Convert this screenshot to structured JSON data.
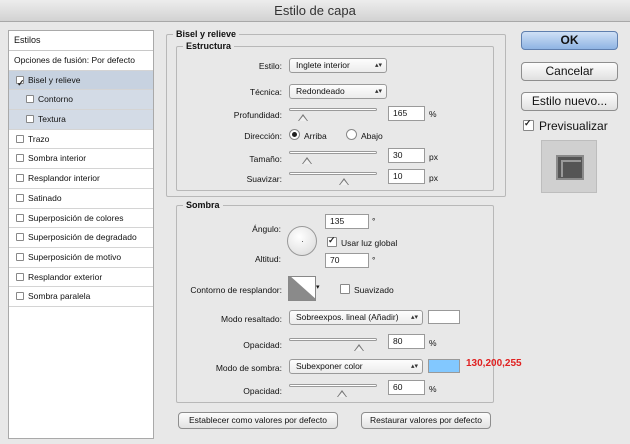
{
  "window": {
    "title": "Estilo de capa"
  },
  "left_panel": {
    "header": "Estilos",
    "items": [
      {
        "label": "Opciones de fusión: Por defecto",
        "checkbox": false,
        "checked": false,
        "selected": false,
        "sub": false
      },
      {
        "label": "Bisel y relieve",
        "checkbox": true,
        "checked": true,
        "selected": true,
        "sub": false
      },
      {
        "label": "Contorno",
        "checkbox": true,
        "checked": false,
        "selected": true,
        "sub": true
      },
      {
        "label": "Textura",
        "checkbox": true,
        "checked": false,
        "selected": true,
        "sub": true
      },
      {
        "label": "Trazo",
        "checkbox": true,
        "checked": false,
        "selected": false,
        "sub": false
      },
      {
        "label": "Sombra interior",
        "checkbox": true,
        "checked": false,
        "selected": false,
        "sub": false
      },
      {
        "label": "Resplandor interior",
        "checkbox": true,
        "checked": false,
        "selected": false,
        "sub": false
      },
      {
        "label": "Satinado",
        "checkbox": true,
        "checked": false,
        "selected": false,
        "sub": false
      },
      {
        "label": "Superposición de colores",
        "checkbox": true,
        "checked": false,
        "selected": false,
        "sub": false
      },
      {
        "label": "Superposición de degradado",
        "checkbox": true,
        "checked": false,
        "selected": false,
        "sub": false
      },
      {
        "label": "Superposición de motivo",
        "checkbox": true,
        "checked": false,
        "selected": false,
        "sub": false
      },
      {
        "label": "Resplandor exterior",
        "checkbox": true,
        "checked": false,
        "selected": false,
        "sub": false
      },
      {
        "label": "Sombra paralela",
        "checkbox": true,
        "checked": false,
        "selected": false,
        "sub": false
      }
    ]
  },
  "bevel": {
    "section_title": "Bisel y relieve",
    "structure_title": "Estructura",
    "style_label": "Estilo:",
    "style_value": "Inglete interior",
    "technique_label": "Técnica:",
    "technique_value": "Redondeado",
    "depth_label": "Profundidad:",
    "depth_value": "165",
    "depth_unit": "%",
    "depth_fraction": 0.16,
    "direction_label": "Dirección:",
    "direction_up": "Arriba",
    "direction_down": "Abajo",
    "size_label": "Tamaño:",
    "size_value": "30",
    "size_unit": "px",
    "size_fraction": 0.2,
    "soften_label": "Suavizar:",
    "soften_value": "10",
    "soften_unit": "px",
    "soften_fraction": 0.62
  },
  "shading": {
    "title": "Sombra",
    "angle_label": "Ángulo:",
    "angle_value": "135",
    "angle_unit": "°",
    "global_light_label": "Usar luz global",
    "altitude_label": "Altitud:",
    "altitude_value": "70",
    "altitude_unit": "°",
    "gloss_contour_label": "Contorno de resplandor:",
    "antialiased_label": "Suavizado",
    "highlight_mode_label": "Modo resaltado:",
    "highlight_mode_value": "Sobreexpos. lineal (Añadir)",
    "highlight_color": "#ffffff",
    "highlight_opacity_label": "Opacidad:",
    "highlight_opacity_value": "80",
    "highlight_opacity_unit": "%",
    "highlight_opacity_fraction": 0.8,
    "shadow_mode_label": "Modo de sombra:",
    "shadow_mode_value": "Subexponer color",
    "shadow_color": "#82c8ff",
    "shadow_rgb_note": "130,200,255",
    "shadow_rgb_note_color": "#e02020",
    "shadow_opacity_label": "Opacidad:",
    "shadow_opacity_value": "60",
    "shadow_opacity_unit": "%",
    "shadow_opacity_fraction": 0.6
  },
  "bottom_buttons": {
    "make_default": "Establecer como valores por defecto",
    "reset_default": "Restaurar valores por defecto"
  },
  "right_panel": {
    "ok": "OK",
    "cancel": "Cancelar",
    "new_style": "Estilo nuevo...",
    "preview_label": "Previsualizar"
  }
}
